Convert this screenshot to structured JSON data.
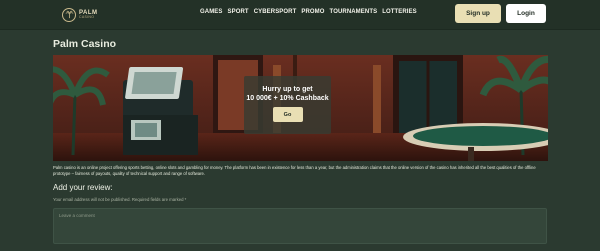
{
  "header": {
    "logo": {
      "name": "PALM",
      "sub": "CASINO"
    },
    "nav": [
      "GAMES",
      "SPORT",
      "CYBERSPORT",
      "PROMO",
      "TOURNAMENTS",
      "LOTTERIES"
    ],
    "signup_label": "Sign up",
    "login_label": "Login"
  },
  "page": {
    "title": "Palm Casino"
  },
  "banner": {
    "promo_line1": "Hurry up to get",
    "promo_line2": "10 000€ + 10% Cashback",
    "button_label": "Go"
  },
  "description": "Palm casino is an online project offering sports betting, online slots and gambling for money. The platform has been in existence for less than a year, but the administration claims that the online version of the casino has inherited all the best qualities of the offline prototype – fairness of payouts, quality of technical support and range of software.",
  "review": {
    "heading": "Add your review:",
    "note": "Your email address will not be published. Required fields are marked *",
    "placeholder": "Leave a comment"
  },
  "colors": {
    "background": "#2b3a30",
    "topbar": "#233127",
    "accent": "#e9dfb4",
    "white": "#ffffff"
  }
}
